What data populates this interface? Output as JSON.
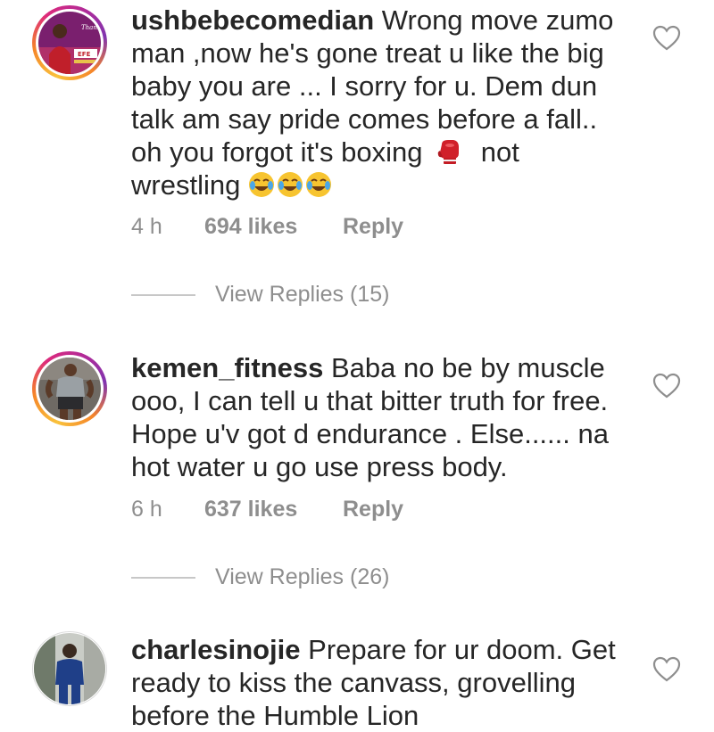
{
  "comments": [
    {
      "username": "ushbebecomedian",
      "text_part1": " Wrong move zumo man ,now he's gone treat u like the big baby you are ... I sorry for u. Dem dun talk am say pride comes before a fall.. oh you forgot it's boxing",
      "text_part2": "not wrestling",
      "emoji_after_part1": "boxing-glove-icon",
      "emoji_end": "face-with-tears-of-joy-icon",
      "time": "4 h",
      "likes": "694 likes",
      "reply_label": "Reply",
      "view_replies": "View Replies (15)",
      "avatar_ring": "story-gradient",
      "avatar_caption": "Thank You",
      "avatar_badge": "EFE"
    },
    {
      "username": "kemen_fitness",
      "text": " Baba no be by muscle ooo, I can tell u that bitter truth for free. Hope u'v got d endurance . Else...... na hot water u go use press body.",
      "time": "6 h",
      "likes": "637 likes",
      "reply_label": "Reply",
      "view_replies": "View Replies (26)",
      "avatar_ring": "story-gradient"
    },
    {
      "username": "charlesinojie",
      "text": " Prepare for ur doom. Get ready to kiss the canvass, grovelling before the Humble Lion",
      "avatar_ring": "none"
    }
  ],
  "colors": {
    "text": "#262626",
    "secondary": "#8e8e8e",
    "ring_gradient": [
      "#f9c23c",
      "#f58529",
      "#dd2a7b",
      "#8134af"
    ]
  }
}
